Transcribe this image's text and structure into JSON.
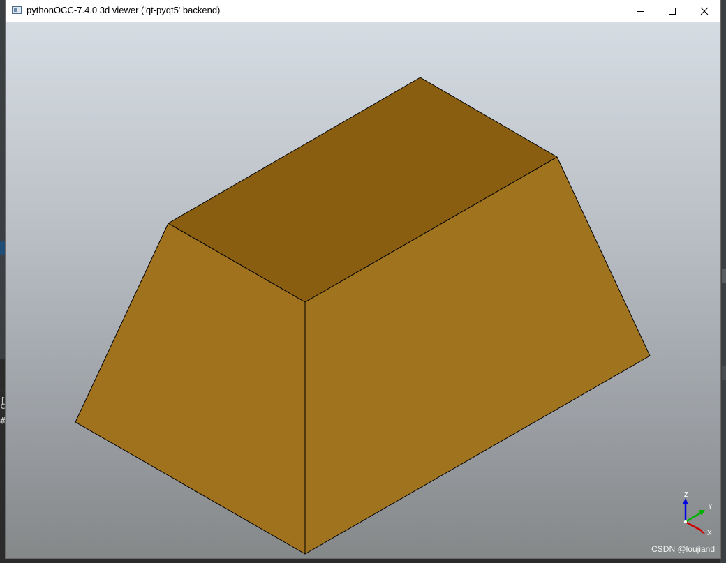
{
  "window": {
    "title": "pythonOCC-7.4.0 3d viewer ('qt-pyqt5' backend)",
    "icon": "app-window-icon",
    "controls": {
      "minimize": "minimize-icon",
      "maximize": "maximize-icon",
      "close": "close-icon"
    }
  },
  "viewport": {
    "shape": "frustum",
    "colors": {
      "face_top": "#8a5e10",
      "face_left": "#a0721e",
      "face_right": "#a0731f",
      "edge": "#000000",
      "background_top": "#d5dce3",
      "background_bottom": "#858889"
    },
    "triad": {
      "x_label": "X",
      "y_label": "Y",
      "z_label": "Z",
      "x_color": "#d00000",
      "y_color": "#00b000",
      "z_color": "#0000e0"
    }
  },
  "background_app": {
    "terminal_fragments": [
      "-[",
      "c",
      "#"
    ]
  },
  "watermark": "CSDN @loujiand"
}
